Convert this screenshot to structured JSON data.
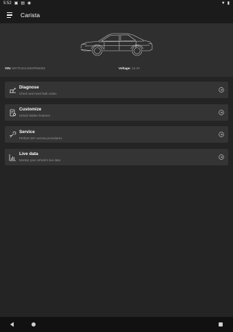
{
  "status_bar": {
    "time": "5:52",
    "icons": [
      "image-icon",
      "sd-card-icon",
      "sync-icon",
      "wifi-icon",
      "battery-icon"
    ]
  },
  "app_bar": {
    "title": "Carista"
  },
  "hero": {
    "vin_label": "VIN:",
    "vin_value": "WVTCZALXZGPM4302",
    "voltage_label": "Voltage:",
    "voltage_value": "14.4V"
  },
  "menu": [
    {
      "title": "Diagnose",
      "subtitle": "Check and reset fault codes",
      "icon": "diagnose-icon"
    },
    {
      "title": "Customize",
      "subtitle": "Unlock hidden features",
      "icon": "customize-icon"
    },
    {
      "title": "Service",
      "subtitle": "Perform DIY service procedures",
      "icon": "service-wrench-icon"
    },
    {
      "title": "Live data",
      "subtitle": "Monitor your vehicle's live data",
      "icon": "live-data-icon"
    }
  ],
  "colors": {
    "background": "#242424",
    "card": "#343434",
    "hero": "#2f2f2f",
    "accent_icon": "#e8e8e8"
  }
}
